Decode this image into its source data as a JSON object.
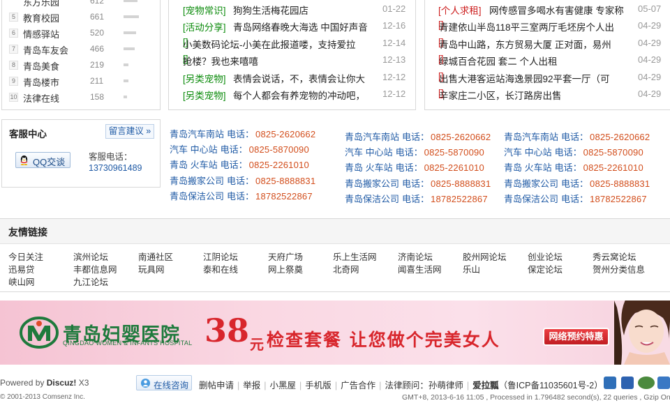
{
  "ranking": {
    "items": [
      {
        "rank": "",
        "name": "东方乐园",
        "count": "612",
        "bar": 0.5
      },
      {
        "rank": "5",
        "name": "教育校园",
        "count": "661",
        "bar": 0.55
      },
      {
        "rank": "6",
        "name": "情感驿站",
        "count": "520",
        "bar": 0.44
      },
      {
        "rank": "7",
        "name": "青岛车友会",
        "count": "466",
        "bar": 0.39
      },
      {
        "rank": "8",
        "name": "青岛美食",
        "count": "219",
        "bar": 0.18
      },
      {
        "rank": "9",
        "name": "青岛楼市",
        "count": "211",
        "bar": 0.18
      },
      {
        "rank": "10",
        "name": "法律在线",
        "count": "158",
        "bar": 0.13
      }
    ]
  },
  "news_mid": {
    "items": [
      {
        "cat": "[宠物常识]",
        "title": "狗狗生活梅花园店",
        "date": "01-22"
      },
      {
        "cat": "[活动分享]",
        "title": "青岛网络春晚大海选 中国好声音",
        "date": "12-16"
      },
      {
        "cat": "[]",
        "title": "小美数码论坛-小美在此报道喽，支持爱拉",
        "date": "12-14"
      },
      {
        "cat": "[]",
        "title": "抢楼？我也来嘻嘻",
        "date": "12-13"
      },
      {
        "cat": "[另类宠物]",
        "title": "表情会说话，不，表情会让你大",
        "date": "12-12"
      },
      {
        "cat": "[另类宠物]",
        "title": "每个人都会有养宠物的冲动吧，",
        "date": "12-12"
      }
    ]
  },
  "news_right": {
    "items": [
      {
        "cat": "[个人求租]",
        "title": "网传感冒多喝水有害健康 专家称",
        "date": "05-07"
      },
      {
        "cat": "[]",
        "title": "青建依山半岛118平三室两厅毛坯房个人出",
        "date": "04-29"
      },
      {
        "cat": "[]",
        "title": "青岛中山路，东方贸易大厦 正对面，易州",
        "date": "04-29"
      },
      {
        "cat": "[]",
        "title": "绿城百合花园 套二 个人出租",
        "date": "04-29"
      },
      {
        "cat": "[]",
        "title": "出售大港客运站海逸景园92平套一厅（可",
        "date": "04-29"
      },
      {
        "cat": "[]",
        "title": "辛家庄二小区，长汀路房出售",
        "date": "04-29"
      }
    ]
  },
  "service": {
    "title": "客服中心",
    "message_button": "留言建议 »",
    "qq_button": "QQ交谈",
    "phone_label": "客服电话：",
    "phone": "13730961489"
  },
  "phones": {
    "label": "电话：",
    "entries": [
      {
        "name": "青岛汽车南站",
        "number": "0825-2620662"
      },
      {
        "name": "汽车 中心站",
        "number": "0825-5870090"
      },
      {
        "name": "青岛 火车站",
        "number": "0825-2261010"
      },
      {
        "name": "青岛搬家公司",
        "number": "0825-8888831"
      },
      {
        "name": "青岛保洁公司",
        "number": "18782522867"
      }
    ]
  },
  "links": {
    "title": "友情链接",
    "rows": [
      [
        "今日关注",
        "滨州论坛",
        "南通社区",
        "江阴论坛",
        "天府广场",
        "乐上生活网",
        "济南论坛",
        "胶州网论坛",
        "创业论坛",
        "秀云窝论坛"
      ],
      [
        "迅易贷",
        "丰都信息网",
        "玩具网",
        "泰和在线",
        "网上祭奠",
        "北奇网",
        "闻喜生活网",
        "乐山",
        "保定论坛",
        "贺州分类信息"
      ],
      [
        "峡山网",
        "九江论坛"
      ]
    ]
  },
  "banner": {
    "name": "青岛妇婴医院",
    "name_en": "QINGDAO WOMEN & INFANTS HOSPITAL",
    "price": "38",
    "unit": "元",
    "slogan": "检查套餐 让您做个完美女人",
    "button": "网络预约特惠"
  },
  "footer": {
    "powered_prefix": "Powered by",
    "powered_brand": "Discuz!",
    "powered_version": "X3",
    "copyright": "© 2001-2013 Comsenz Inc.",
    "online_button": "在线咨询",
    "nav": [
      "删帖申请",
      "举报",
      "小黑屋",
      "手机版",
      "广告合作",
      "法律顾问：孙萌律师"
    ],
    "site_name": "爱拉瓢",
    "icp": "（鲁ICP备11035601号-2）",
    "meta": "GMT+8, 2013-6-16 11:05 , Processed in 1.796482 second(s), 22 queries , Gzip On."
  },
  "colors": {
    "link_blue": "#1f5aa5",
    "phone_orange": "#d24d1b",
    "cat_green": "#0a8a0a",
    "cat_red": "#cc1b1b",
    "banner_red": "#d8262c",
    "banner_green": "#1e7a3c"
  }
}
